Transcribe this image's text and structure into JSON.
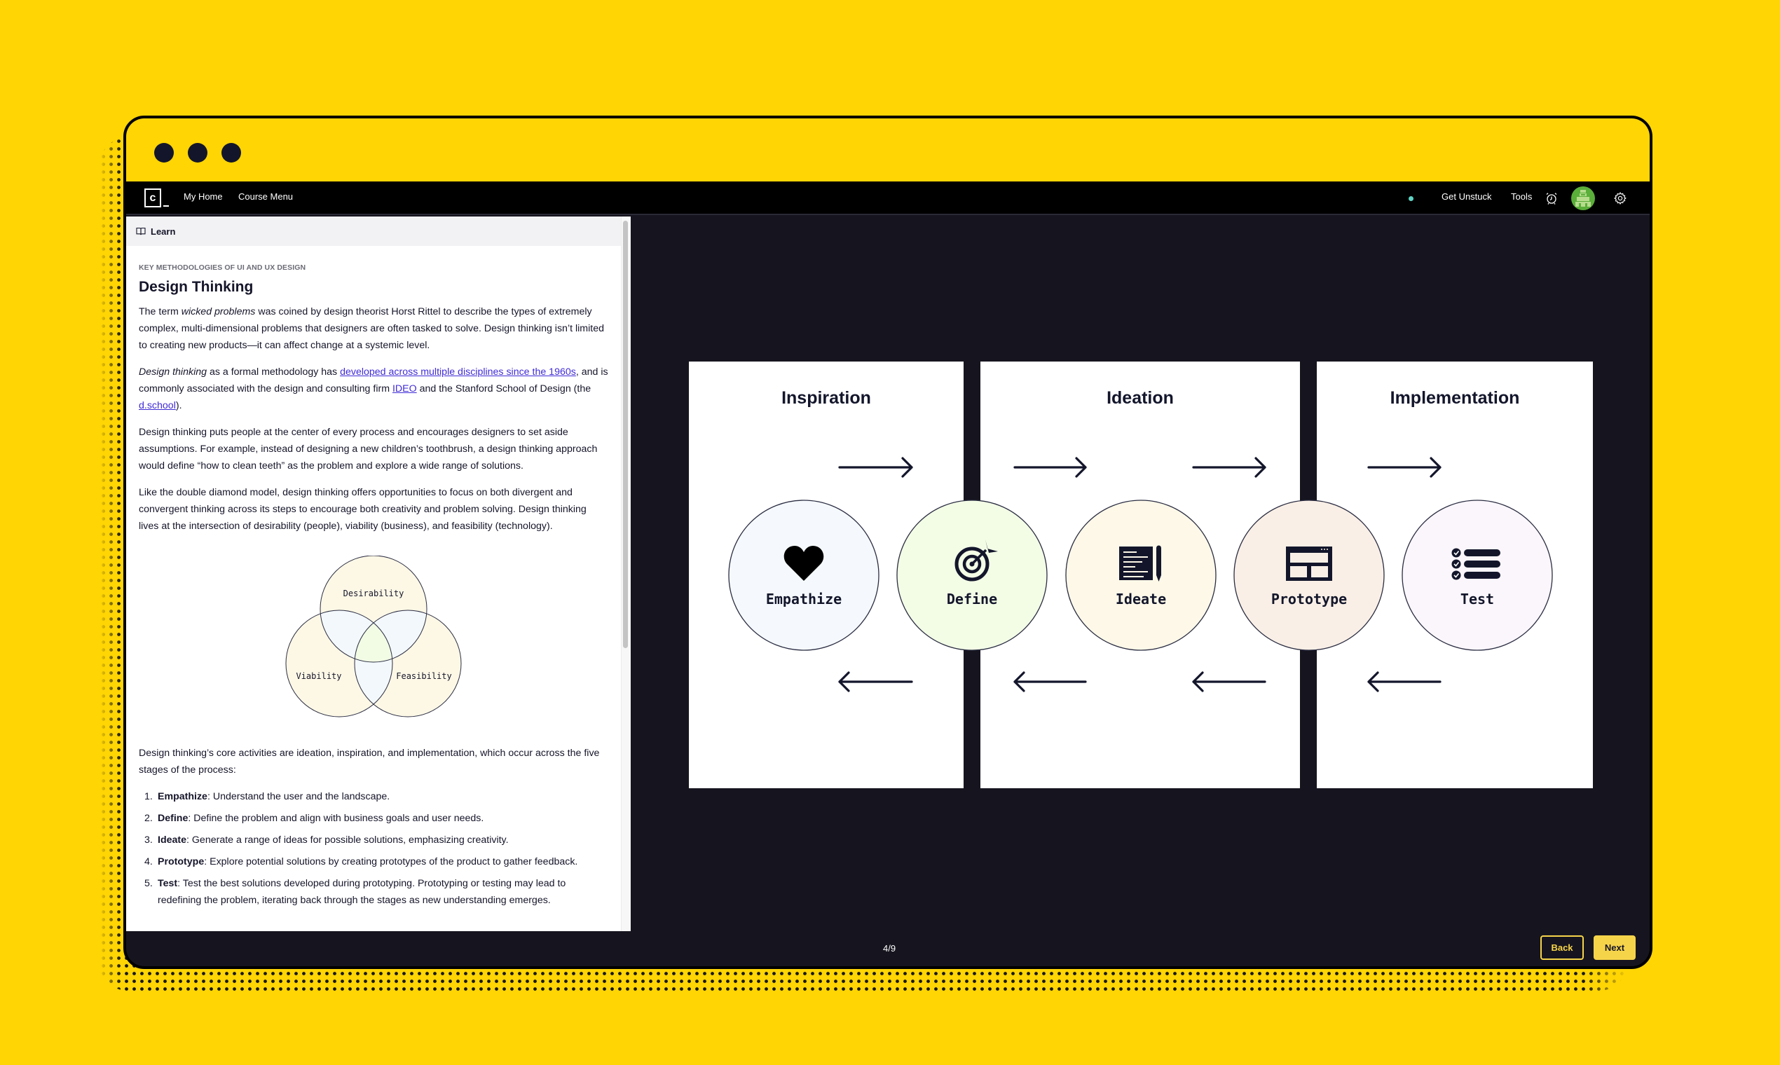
{
  "window": {
    "traffic_dots": [
      "dot-1",
      "dot-2",
      "dot-3"
    ]
  },
  "navbar": {
    "logo_letter": "c",
    "links": [
      "My Home",
      "Course Menu"
    ],
    "right_links": [
      "Get Unstuck",
      "Tools"
    ],
    "status_color": "#5fd4c4",
    "icons": [
      "alarm-clock-icon",
      "avatar",
      "gear-icon"
    ]
  },
  "sidebar": {
    "header_label": "Learn",
    "eyebrow": "KEY METHODOLOGIES OF UI AND UX DESIGN",
    "title": "Design Thinking",
    "p1": {
      "pre": "The term ",
      "em": "wicked problems",
      "post": " was coined by design theorist Horst Rittel to describe the types of extremely complex, multi-dimensional problems that designers are often tasked to solve. Design thinking isn’t limited to creating new products—it can affect change at a systemic level."
    },
    "p2": {
      "em": "Design thinking",
      "t1": " as a formal methodology has ",
      "link1": "developed across multiple disciplines since the 1960s",
      "t2": ", and is commonly associated with the design and consulting firm ",
      "link2": "IDEO",
      "t3": " and the Stanford School of Design (the ",
      "link3": "d.school",
      "t4": ")."
    },
    "p3": "Design thinking puts people at the center of every process and encourages designers to set aside assumptions. For example, instead of designing a new children’s toothbrush, a design thinking approach would define “how to clean teeth” as the problem and explore a wide range of solutions.",
    "p4": "Like the double diamond model, design thinking offers opportunities to focus on both divergent and convergent thinking across its steps to encourage both creativity and problem solving. Design thinking lives at the intersection of desirability (people), viability (business), and feasibility (technology).",
    "venn": {
      "labels": [
        "Desirability",
        "Viability",
        "Feasibility"
      ]
    },
    "p5": "Design thinking’s core activities are ideation, inspiration, and implementation, which occur across the five stages of the process:",
    "stages_list": [
      {
        "num": "1.",
        "term": "Empathize",
        "desc": ": Understand the user and the landscape."
      },
      {
        "num": "2.",
        "term": "Define",
        "desc": ": Define the problem and align with business goals and user needs."
      },
      {
        "num": "3.",
        "term": "Ideate",
        "desc": ": Generate a range of ideas for possible solutions, emphasizing creativity."
      },
      {
        "num": "4.",
        "term": "Prototype",
        "desc": ": Explore potential solutions by creating prototypes of the product to gather feedback."
      },
      {
        "num": "5.",
        "term": "Test",
        "desc": ": Test the best solutions developed during prototyping. Prototyping or testing may lead to redefining the problem, iterating back through the stages as new understanding emerges."
      }
    ]
  },
  "diagram": {
    "phases": [
      "Inspiration",
      "Ideation",
      "Implementation"
    ],
    "stages": [
      {
        "label": "Empathize",
        "icon": "heart-icon",
        "color": "#f5f9fd"
      },
      {
        "label": "Define",
        "icon": "target-icon",
        "color": "#f3fde6"
      },
      {
        "label": "Ideate",
        "icon": "document-pen-icon",
        "color": "#fdf8e8"
      },
      {
        "label": "Prototype",
        "icon": "layout-wireframe-icon",
        "color": "#f9efe6"
      },
      {
        "label": "Test",
        "icon": "checklist-icon",
        "color": "#faf6fb"
      }
    ]
  },
  "footer": {
    "page_indicator": "4/9",
    "back_label": "Back",
    "next_label": "Next"
  }
}
